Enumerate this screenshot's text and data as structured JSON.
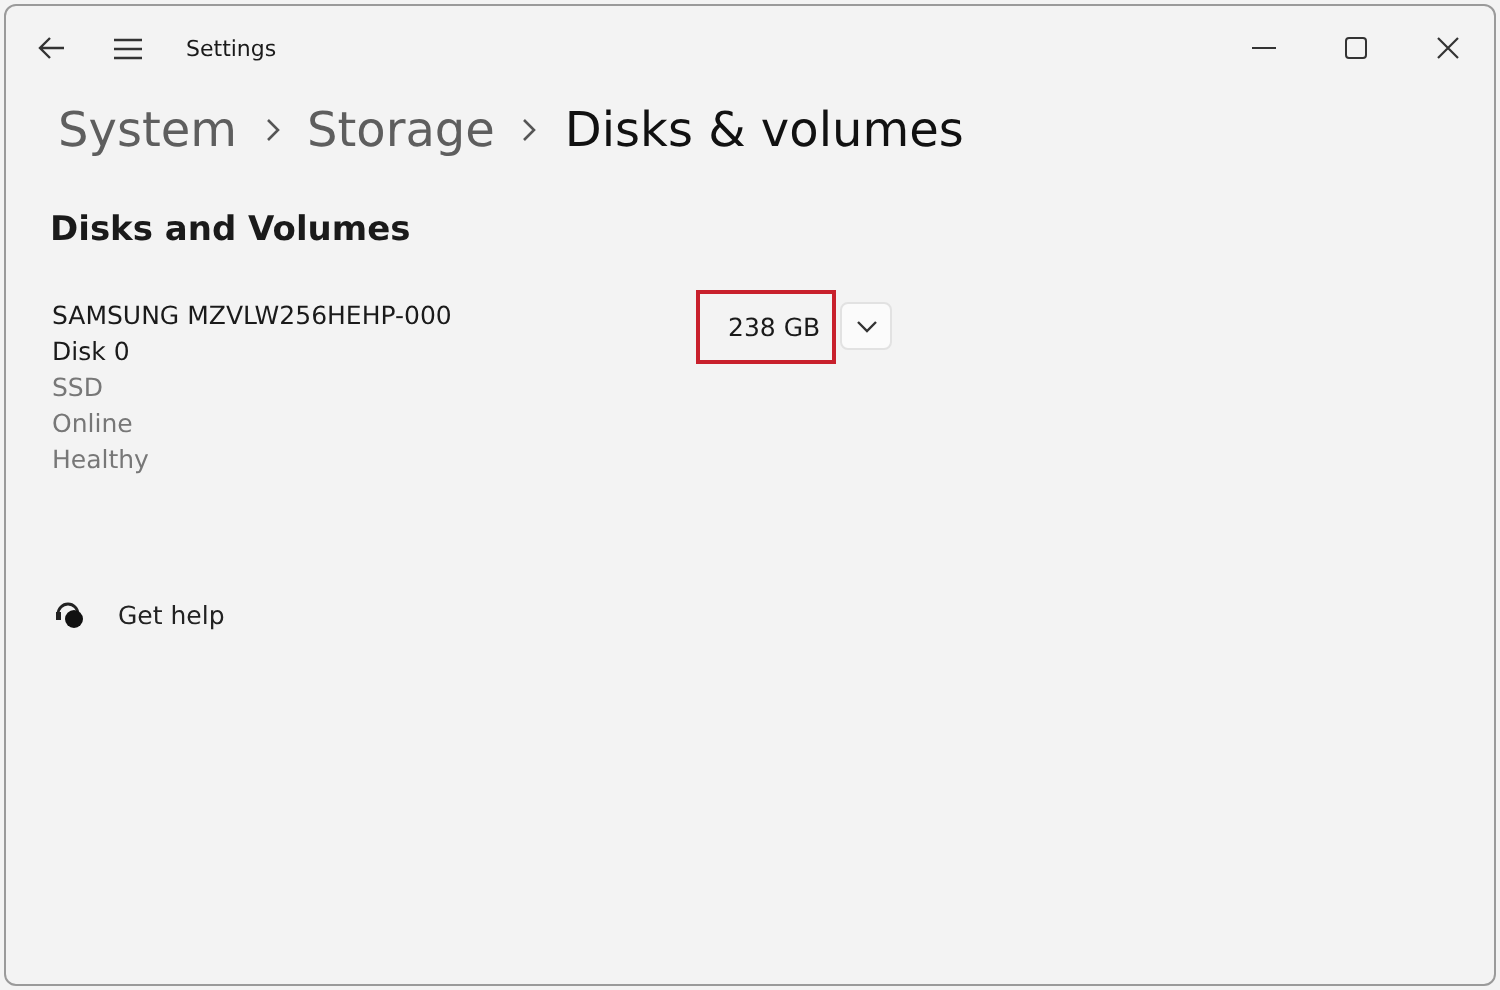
{
  "window": {
    "title": "Settings"
  },
  "breadcrumb": [
    {
      "label": "System",
      "selected": false
    },
    {
      "label": "Storage",
      "selected": false
    },
    {
      "label": "Disks & volumes",
      "selected": true
    }
  ],
  "section_title": "Disks and Volumes",
  "disk": {
    "model": "SAMSUNG MZVLW256HEHP-000",
    "name": "Disk 0",
    "details": [
      "SSD",
      "Online",
      "Healthy"
    ],
    "size": "238 GB",
    "size_highlighted": true,
    "expanded": false
  },
  "help_link": "Get help"
}
